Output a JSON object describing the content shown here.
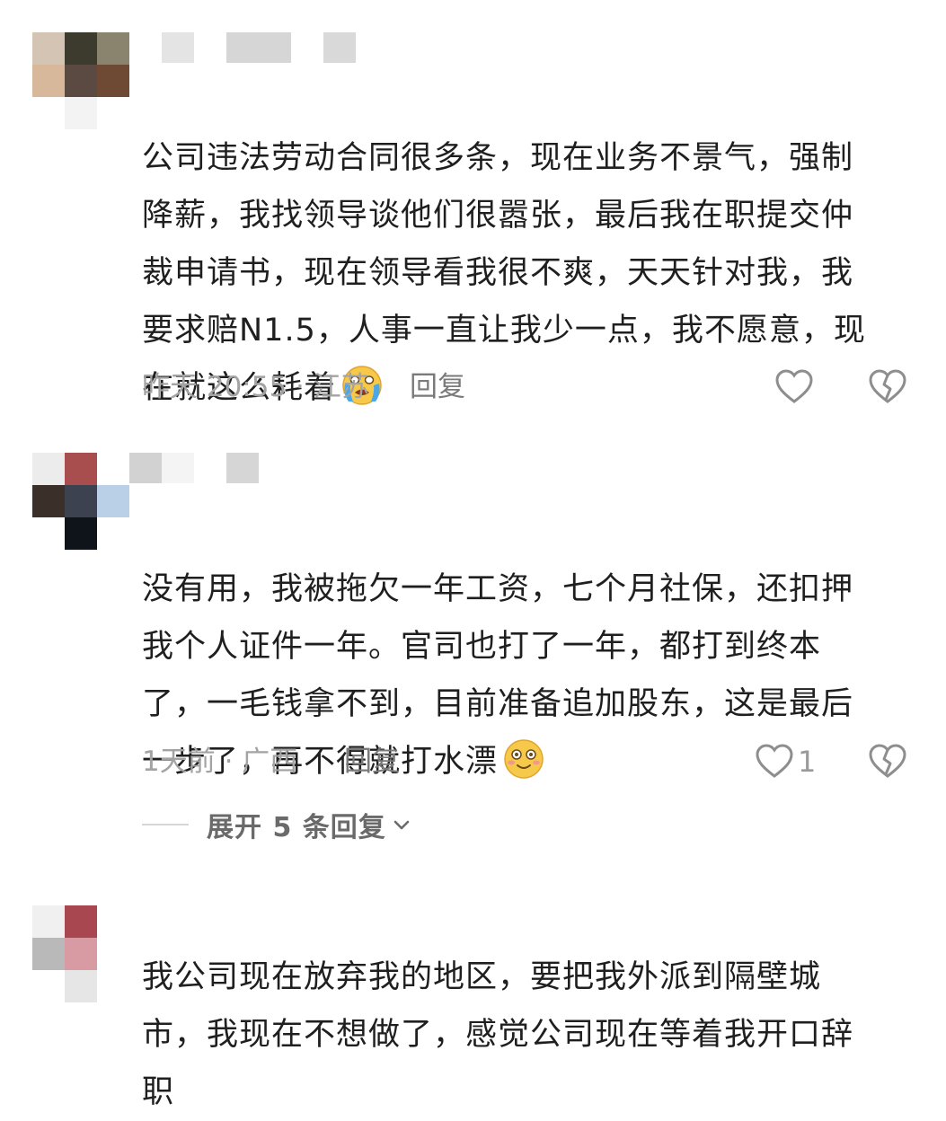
{
  "comments": [
    {
      "text": "公司违法劳动合同很多条，现在业务不景气，强制\n降薪，我找领导谈他们很嚣张，最后我在职提交仲\n裁申请书，现在领导看我很不爽，天天针对我，我\n要求赔N1.5，人事一直让我少一点，我不愿意，现\n在就这么耗着",
      "emoji": "crying-face",
      "meta": "昨天 20:55 · 江苏",
      "reply_label": "回复",
      "like_count": "",
      "avatar_colors": [
        "#d3c4b3",
        "#3d3a2e",
        "#8a836e",
        "#d8b89a",
        "#5a4a42",
        "#6e4a34"
      ]
    },
    {
      "text": "没有用，我被拖欠一年工资，七个月社保，还扣押\n我个人证件一年。官司也打了一年，都打到终本\n了，一毛钱拿不到，目前准备追加股东，这是最后\n一步了，再不得就打水漂",
      "emoji": "smiling-face",
      "meta": "1天前 · 广西",
      "reply_label": "回复",
      "like_count": "1",
      "expand_label": "展开 5 条回复",
      "avatar_colors": [
        "#ececec",
        "#a84e4e",
        "#ffffff",
        "#3b3029",
        "#3d4250",
        "#b9d0e6",
        "#ffffff",
        "#0f141a",
        "#ffffff"
      ]
    },
    {
      "text": "我公司现在放弃我的地区，要把我外派到隔壁城\n市，我现在不想做了，感觉公司现在等着我开口辞\n职",
      "avatar_colors": [
        "#f0f0f0",
        "#a8474f",
        "#ffffff",
        "#b9b9b9",
        "#d89aa3",
        "#ffffff",
        "#ffffff",
        "#e6e6e6",
        "#ffffff"
      ]
    }
  ]
}
